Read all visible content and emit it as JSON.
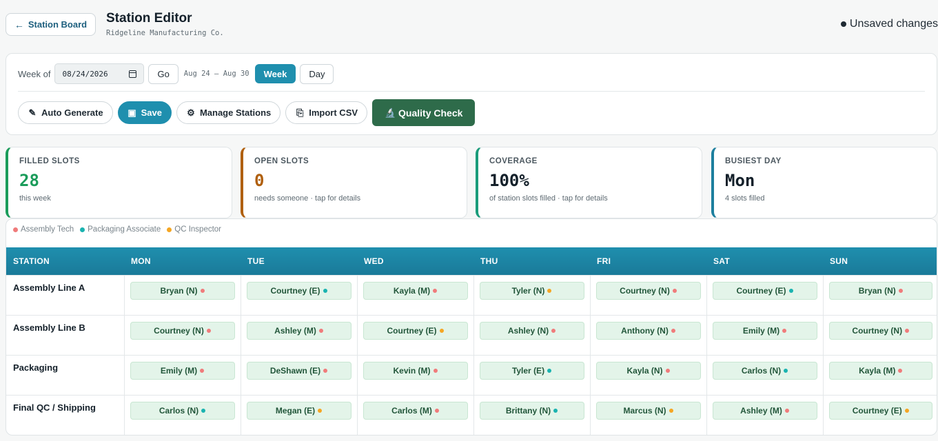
{
  "header": {
    "back_label": "Station Board",
    "title": "Station Editor",
    "company": "Ridgeline Manufacturing Co.",
    "unsaved": "Unsaved changes"
  },
  "toolbar": {
    "week_label": "Week of",
    "date_value": "08/24/2026",
    "go_label": "Go",
    "range": "Aug 24 – Aug 30",
    "week_btn": "Week",
    "day_btn": "Day",
    "auto_generate": "Auto Generate",
    "save": "Save",
    "manage_stations": "Manage Stations",
    "import_csv": "Import CSV",
    "quality_check": "Quality Check"
  },
  "stats": [
    {
      "caption": "FILLED SLOTS",
      "value": "28",
      "sub": "this week",
      "color": "#1a9c5a"
    },
    {
      "caption": "OPEN SLOTS",
      "value": "0",
      "sub": "needs someone · tap for details",
      "color": "#b0600f"
    },
    {
      "caption": "COVERAGE",
      "value": "100%",
      "sub": "of station slots filled · tap for details",
      "color": "#1a9c7a"
    },
    {
      "caption": "BUSIEST DAY",
      "value": "Mon",
      "sub": "4 slots filled",
      "color": "#1d7f9e"
    }
  ],
  "legend": [
    {
      "label": "Assembly Tech",
      "color": "#f07b7b"
    },
    {
      "label": "Packaging Associate",
      "color": "#1ab3b0"
    },
    {
      "label": "QC Inspector",
      "color": "#f5a623"
    }
  ],
  "columns": [
    "STATION",
    "MON",
    "TUE",
    "WED",
    "THU",
    "FRI",
    "SAT",
    "SUN"
  ],
  "rows": [
    {
      "station": "Assembly Line A",
      "cells": [
        {
          "name": "Bryan (N)",
          "role": 0
        },
        {
          "name": "Courtney (E)",
          "role": 1
        },
        {
          "name": "Kayla (M)",
          "role": 0
        },
        {
          "name": "Tyler (N)",
          "role": 2
        },
        {
          "name": "Courtney (N)",
          "role": 0
        },
        {
          "name": "Courtney (E)",
          "role": 1
        },
        {
          "name": "Bryan (N)",
          "role": 0
        }
      ]
    },
    {
      "station": "Assembly Line B",
      "cells": [
        {
          "name": "Courtney (N)",
          "role": 0
        },
        {
          "name": "Ashley (M)",
          "role": 0
        },
        {
          "name": "Courtney (E)",
          "role": 2
        },
        {
          "name": "Ashley (N)",
          "role": 0
        },
        {
          "name": "Anthony (N)",
          "role": 0
        },
        {
          "name": "Emily (M)",
          "role": 0
        },
        {
          "name": "Courtney (N)",
          "role": 0
        }
      ]
    },
    {
      "station": "Packaging",
      "cells": [
        {
          "name": "Emily (M)",
          "role": 0
        },
        {
          "name": "DeShawn (E)",
          "role": 0
        },
        {
          "name": "Kevin (M)",
          "role": 0
        },
        {
          "name": "Tyler (E)",
          "role": 1
        },
        {
          "name": "Kayla (N)",
          "role": 0
        },
        {
          "name": "Carlos (N)",
          "role": 1
        },
        {
          "name": "Kayla (M)",
          "role": 0
        }
      ]
    },
    {
      "station": "Final QC / Shipping",
      "cells": [
        {
          "name": "Carlos (N)",
          "role": 1
        },
        {
          "name": "Megan (E)",
          "role": 2
        },
        {
          "name": "Carlos (M)",
          "role": 0
        },
        {
          "name": "Brittany (N)",
          "role": 1
        },
        {
          "name": "Marcus (N)",
          "role": 2
        },
        {
          "name": "Ashley (M)",
          "role": 0
        },
        {
          "name": "Courtney (E)",
          "role": 2
        }
      ]
    }
  ]
}
